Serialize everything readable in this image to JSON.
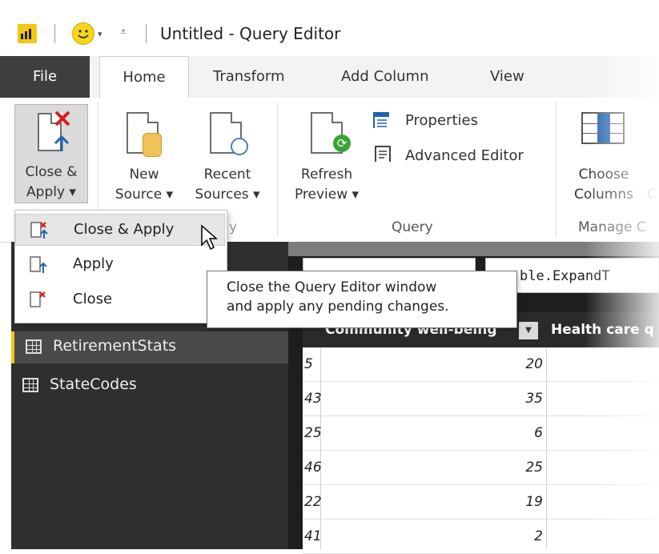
{
  "window": {
    "title": "Untitled - Query Editor"
  },
  "tabs": [
    "File",
    "Home",
    "Transform",
    "Add Column",
    "View"
  ],
  "ribbon": {
    "close_apply": {
      "line1": "Close &",
      "line2": "Apply ▾"
    },
    "new_source": {
      "line1": "New",
      "line2": "Source ▾"
    },
    "recent_sources": {
      "line1": "Recent",
      "line2": "Sources ▾"
    },
    "refresh_preview": {
      "line1": "Refresh",
      "line2": "Preview ▾"
    },
    "properties": "Properties",
    "advanced_editor": "Advanced Editor",
    "choose_columns": {
      "line1": "Choose",
      "line2": "Columns"
    },
    "partial_c": "C",
    "group_query": "Query",
    "group_manage": "Manage C",
    "group_close_fragment": "y"
  },
  "menu": {
    "items": [
      "Close & Apply",
      "Apply",
      "Close"
    ]
  },
  "tooltip": {
    "line1": "Close the Query Editor window",
    "line2": "and apply any pending changes."
  },
  "queries": [
    "RetirementStats",
    "StateCodes"
  ],
  "formula": {
    "text": "ble.ExpandT"
  },
  "grid": {
    "header1": "Community well-being",
    "header2": "Health care q",
    "rows": [
      {
        "n": "5",
        "v": "20"
      },
      {
        "n": "43",
        "v": "35"
      },
      {
        "n": "25",
        "v": "6"
      },
      {
        "n": "46",
        "v": "25"
      },
      {
        "n": "22",
        "v": "19"
      },
      {
        "n": "41",
        "v": "2"
      }
    ]
  }
}
